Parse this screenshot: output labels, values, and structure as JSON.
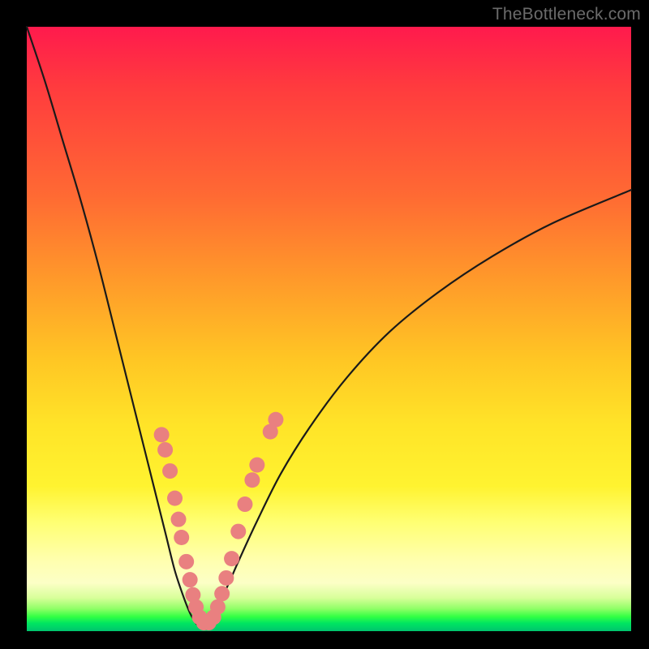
{
  "watermark": "TheBottleneck.com",
  "colors": {
    "curve_stroke": "#1a1a1a",
    "marker_fill": "#e98080",
    "marker_stroke": "#d46b6b"
  },
  "chart_data": {
    "type": "line",
    "title": "",
    "xlabel": "",
    "ylabel": "",
    "xlim": [
      0,
      100
    ],
    "ylim": [
      0,
      100
    ],
    "grid": false,
    "series": [
      {
        "name": "bottleneck-curve",
        "x": [
          0,
          3,
          6,
          9,
          12,
          15,
          17,
          19,
          21,
          23,
          24.5,
          26,
          27,
          27.8,
          28.4,
          29,
          29.8,
          31,
          33,
          35,
          38,
          42,
          47,
          53,
          60,
          68,
          77,
          87,
          100
        ],
        "y": [
          100,
          91,
          81,
          71,
          60,
          48,
          40,
          32,
          24,
          16,
          10,
          5.5,
          3,
          1.6,
          0.9,
          0.9,
          1.6,
          3.4,
          7,
          11.5,
          18,
          26,
          34,
          42,
          49.5,
          56,
          62,
          67.5,
          73
        ]
      }
    ],
    "markers": {
      "name": "highlight-points",
      "points": [
        {
          "x": 22.3,
          "y": 32.5
        },
        {
          "x": 22.9,
          "y": 30.0
        },
        {
          "x": 23.7,
          "y": 26.5
        },
        {
          "x": 24.5,
          "y": 22.0
        },
        {
          "x": 25.1,
          "y": 18.5
        },
        {
          "x": 25.6,
          "y": 15.5
        },
        {
          "x": 26.4,
          "y": 11.5
        },
        {
          "x": 27.0,
          "y": 8.5
        },
        {
          "x": 27.5,
          "y": 6.0
        },
        {
          "x": 28.0,
          "y": 4.0
        },
        {
          "x": 28.6,
          "y": 2.3
        },
        {
          "x": 29.3,
          "y": 1.4
        },
        {
          "x": 30.1,
          "y": 1.4
        },
        {
          "x": 30.9,
          "y": 2.3
        },
        {
          "x": 31.6,
          "y": 4.0
        },
        {
          "x": 32.3,
          "y": 6.2
        },
        {
          "x": 33.0,
          "y": 8.8
        },
        {
          "x": 33.9,
          "y": 12.0
        },
        {
          "x": 35.0,
          "y": 16.5
        },
        {
          "x": 36.1,
          "y": 21.0
        },
        {
          "x": 37.3,
          "y": 25.0
        },
        {
          "x": 38.1,
          "y": 27.5
        },
        {
          "x": 40.3,
          "y": 33.0
        },
        {
          "x": 41.2,
          "y": 35.0
        }
      ]
    }
  }
}
